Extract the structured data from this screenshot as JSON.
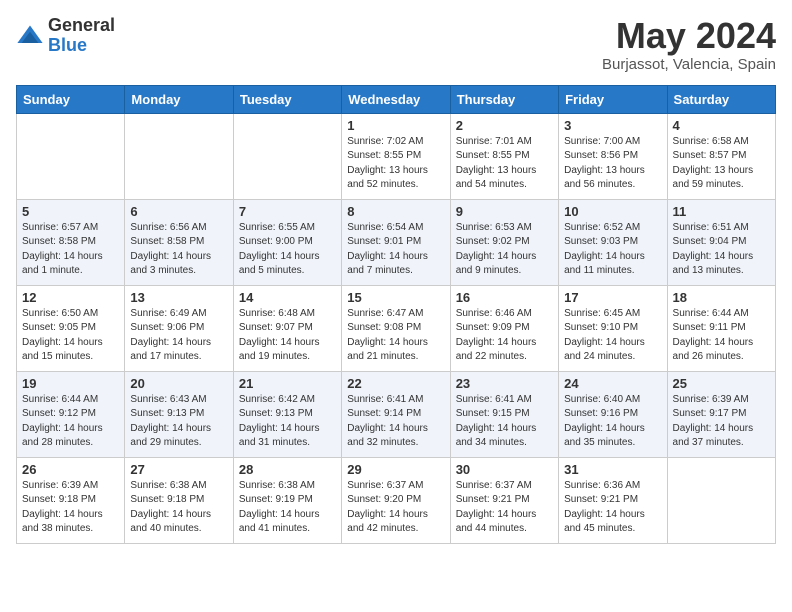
{
  "header": {
    "logo_general": "General",
    "logo_blue": "Blue",
    "month_title": "May 2024",
    "location": "Burjassot, Valencia, Spain"
  },
  "days_of_week": [
    "Sunday",
    "Monday",
    "Tuesday",
    "Wednesday",
    "Thursday",
    "Friday",
    "Saturday"
  ],
  "weeks": [
    [
      {
        "day": "",
        "sunrise": "",
        "sunset": "",
        "daylight": ""
      },
      {
        "day": "",
        "sunrise": "",
        "sunset": "",
        "daylight": ""
      },
      {
        "day": "",
        "sunrise": "",
        "sunset": "",
        "daylight": ""
      },
      {
        "day": "1",
        "sunrise": "Sunrise: 7:02 AM",
        "sunset": "Sunset: 8:55 PM",
        "daylight": "Daylight: 13 hours and 52 minutes."
      },
      {
        "day": "2",
        "sunrise": "Sunrise: 7:01 AM",
        "sunset": "Sunset: 8:55 PM",
        "daylight": "Daylight: 13 hours and 54 minutes."
      },
      {
        "day": "3",
        "sunrise": "Sunrise: 7:00 AM",
        "sunset": "Sunset: 8:56 PM",
        "daylight": "Daylight: 13 hours and 56 minutes."
      },
      {
        "day": "4",
        "sunrise": "Sunrise: 6:58 AM",
        "sunset": "Sunset: 8:57 PM",
        "daylight": "Daylight: 13 hours and 59 minutes."
      }
    ],
    [
      {
        "day": "5",
        "sunrise": "Sunrise: 6:57 AM",
        "sunset": "Sunset: 8:58 PM",
        "daylight": "Daylight: 14 hours and 1 minute."
      },
      {
        "day": "6",
        "sunrise": "Sunrise: 6:56 AM",
        "sunset": "Sunset: 8:58 PM",
        "daylight": "Daylight: 14 hours and 3 minutes."
      },
      {
        "day": "7",
        "sunrise": "Sunrise: 6:55 AM",
        "sunset": "Sunset: 9:00 PM",
        "daylight": "Daylight: 14 hours and 5 minutes."
      },
      {
        "day": "8",
        "sunrise": "Sunrise: 6:54 AM",
        "sunset": "Sunset: 9:01 PM",
        "daylight": "Daylight: 14 hours and 7 minutes."
      },
      {
        "day": "9",
        "sunrise": "Sunrise: 6:53 AM",
        "sunset": "Sunset: 9:02 PM",
        "daylight": "Daylight: 14 hours and 9 minutes."
      },
      {
        "day": "10",
        "sunrise": "Sunrise: 6:52 AM",
        "sunset": "Sunset: 9:03 PM",
        "daylight": "Daylight: 14 hours and 11 minutes."
      },
      {
        "day": "11",
        "sunrise": "Sunrise: 6:51 AM",
        "sunset": "Sunset: 9:04 PM",
        "daylight": "Daylight: 14 hours and 13 minutes."
      }
    ],
    [
      {
        "day": "12",
        "sunrise": "Sunrise: 6:50 AM",
        "sunset": "Sunset: 9:05 PM",
        "daylight": "Daylight: 14 hours and 15 minutes."
      },
      {
        "day": "13",
        "sunrise": "Sunrise: 6:49 AM",
        "sunset": "Sunset: 9:06 PM",
        "daylight": "Daylight: 14 hours and 17 minutes."
      },
      {
        "day": "14",
        "sunrise": "Sunrise: 6:48 AM",
        "sunset": "Sunset: 9:07 PM",
        "daylight": "Daylight: 14 hours and 19 minutes."
      },
      {
        "day": "15",
        "sunrise": "Sunrise: 6:47 AM",
        "sunset": "Sunset: 9:08 PM",
        "daylight": "Daylight: 14 hours and 21 minutes."
      },
      {
        "day": "16",
        "sunrise": "Sunrise: 6:46 AM",
        "sunset": "Sunset: 9:09 PM",
        "daylight": "Daylight: 14 hours and 22 minutes."
      },
      {
        "day": "17",
        "sunrise": "Sunrise: 6:45 AM",
        "sunset": "Sunset: 9:10 PM",
        "daylight": "Daylight: 14 hours and 24 minutes."
      },
      {
        "day": "18",
        "sunrise": "Sunrise: 6:44 AM",
        "sunset": "Sunset: 9:11 PM",
        "daylight": "Daylight: 14 hours and 26 minutes."
      }
    ],
    [
      {
        "day": "19",
        "sunrise": "Sunrise: 6:44 AM",
        "sunset": "Sunset: 9:12 PM",
        "daylight": "Daylight: 14 hours and 28 minutes."
      },
      {
        "day": "20",
        "sunrise": "Sunrise: 6:43 AM",
        "sunset": "Sunset: 9:13 PM",
        "daylight": "Daylight: 14 hours and 29 minutes."
      },
      {
        "day": "21",
        "sunrise": "Sunrise: 6:42 AM",
        "sunset": "Sunset: 9:13 PM",
        "daylight": "Daylight: 14 hours and 31 minutes."
      },
      {
        "day": "22",
        "sunrise": "Sunrise: 6:41 AM",
        "sunset": "Sunset: 9:14 PM",
        "daylight": "Daylight: 14 hours and 32 minutes."
      },
      {
        "day": "23",
        "sunrise": "Sunrise: 6:41 AM",
        "sunset": "Sunset: 9:15 PM",
        "daylight": "Daylight: 14 hours and 34 minutes."
      },
      {
        "day": "24",
        "sunrise": "Sunrise: 6:40 AM",
        "sunset": "Sunset: 9:16 PM",
        "daylight": "Daylight: 14 hours and 35 minutes."
      },
      {
        "day": "25",
        "sunrise": "Sunrise: 6:39 AM",
        "sunset": "Sunset: 9:17 PM",
        "daylight": "Daylight: 14 hours and 37 minutes."
      }
    ],
    [
      {
        "day": "26",
        "sunrise": "Sunrise: 6:39 AM",
        "sunset": "Sunset: 9:18 PM",
        "daylight": "Daylight: 14 hours and 38 minutes."
      },
      {
        "day": "27",
        "sunrise": "Sunrise: 6:38 AM",
        "sunset": "Sunset: 9:18 PM",
        "daylight": "Daylight: 14 hours and 40 minutes."
      },
      {
        "day": "28",
        "sunrise": "Sunrise: 6:38 AM",
        "sunset": "Sunset: 9:19 PM",
        "daylight": "Daylight: 14 hours and 41 minutes."
      },
      {
        "day": "29",
        "sunrise": "Sunrise: 6:37 AM",
        "sunset": "Sunset: 9:20 PM",
        "daylight": "Daylight: 14 hours and 42 minutes."
      },
      {
        "day": "30",
        "sunrise": "Sunrise: 6:37 AM",
        "sunset": "Sunset: 9:21 PM",
        "daylight": "Daylight: 14 hours and 44 minutes."
      },
      {
        "day": "31",
        "sunrise": "Sunrise: 6:36 AM",
        "sunset": "Sunset: 9:21 PM",
        "daylight": "Daylight: 14 hours and 45 minutes."
      },
      {
        "day": "",
        "sunrise": "",
        "sunset": "",
        "daylight": ""
      }
    ]
  ]
}
